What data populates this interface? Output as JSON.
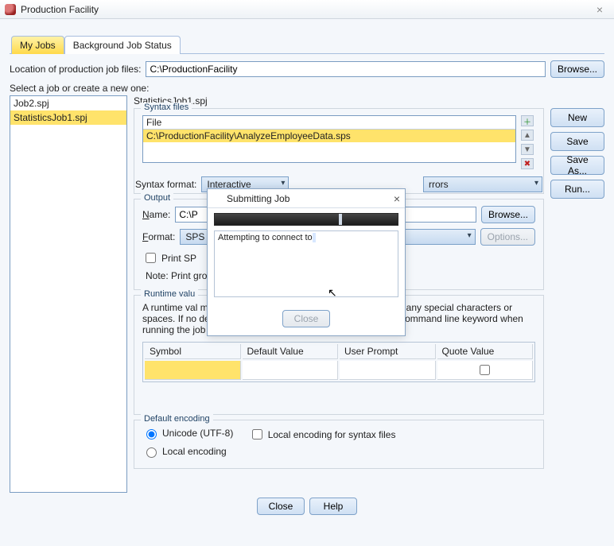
{
  "window": {
    "title": "Production Facility",
    "icon": "app-icon"
  },
  "tabs": {
    "my_jobs": "My Jobs",
    "bg_status": "Background Job Status"
  },
  "location": {
    "label": "Location of production job files:",
    "value": "C:\\ProductionFacility",
    "browse": "Browse..."
  },
  "jobs": {
    "select_label": "Select a job or create a new one:",
    "items": [
      "Job2.spj",
      "StatisticsJob1.spj"
    ],
    "selected_index": 1,
    "current_file": "StatisticsJob1.spj"
  },
  "right_buttons": {
    "new": "New",
    "save": "Save",
    "save_as": "Save As...",
    "run": "Run..."
  },
  "syntax": {
    "group": "Syntax files",
    "header": "File",
    "rows": [
      "C:\\ProductionFacility\\AnalyzeEmployeeData.sps"
    ],
    "icons": {
      "add": "add-icon",
      "up": "up-icon",
      "down": "down-icon",
      "delete": "delete-icon"
    },
    "format_label": "Syntax format:",
    "format_value": "Interactive",
    "errors_label": "rrors",
    "errors_value": ""
  },
  "output": {
    "group": "Output",
    "name_label": "Name:",
    "name_value": "C:\\P",
    "browse": "Browse...",
    "format_label": "Format:",
    "format_value": "SPS",
    "options": "Options...",
    "print_check": "Print SP",
    "note": "Note: Print                                                                   ground on a server."
  },
  "runtime": {
    "group": "Runtime valu",
    "para": "A runtime val                                                                                     mbol starts with an @ sign and must not contain any special characters or spaces. If no default value is specified, do not use the 'silent' command line keyword when running the job from the command line.",
    "cols": {
      "symbol": "Symbol",
      "default": "Default Value",
      "prompt": "User Prompt",
      "quote": "Quote Value"
    }
  },
  "encoding": {
    "group": "Default encoding",
    "unicode": "Unicode (UTF-8)",
    "local_syntax": "Local encoding for syntax files",
    "local": "Local encoding"
  },
  "bottom": {
    "close": "Close",
    "help": "Help"
  },
  "dialog": {
    "title": "Submitting Job",
    "msg_prefix": "Attempting to connect to",
    "msg_redacted": " ",
    "close": "Close"
  }
}
